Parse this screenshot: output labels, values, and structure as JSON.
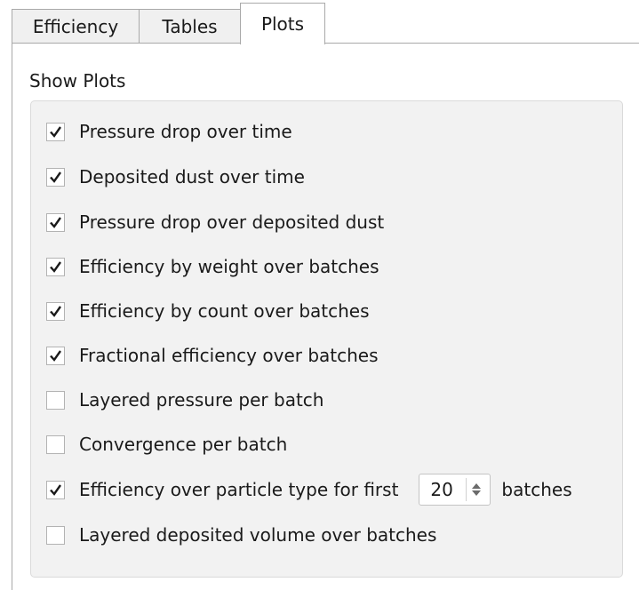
{
  "tabs": [
    {
      "label": "Efficiency"
    },
    {
      "label": "Tables"
    },
    {
      "label": "Plots",
      "active": true
    }
  ],
  "section_title": "Show Plots",
  "options": [
    {
      "label": "Pressure drop over time",
      "checked": true
    },
    {
      "label": "Deposited dust over time",
      "checked": true
    },
    {
      "label": "Pressure drop over deposited dust",
      "checked": true
    },
    {
      "label": "Efficiency by weight over batches",
      "checked": true
    },
    {
      "label": "Efficiency by count over batches",
      "checked": true
    },
    {
      "label": "Fractional efficiency over batches",
      "checked": true
    },
    {
      "label": "Layered pressure per batch",
      "checked": false
    },
    {
      "label": "Convergence per batch",
      "checked": false
    },
    {
      "label": "Efficiency over particle type for first",
      "checked": true,
      "spin_value": "20",
      "suffix": "batches"
    },
    {
      "label": "Layered deposited volume over batches",
      "checked": false
    }
  ],
  "colors": {
    "border": "#a9a9a9",
    "group_bg": "#f2f2f2",
    "check": "#1a1a1a"
  }
}
